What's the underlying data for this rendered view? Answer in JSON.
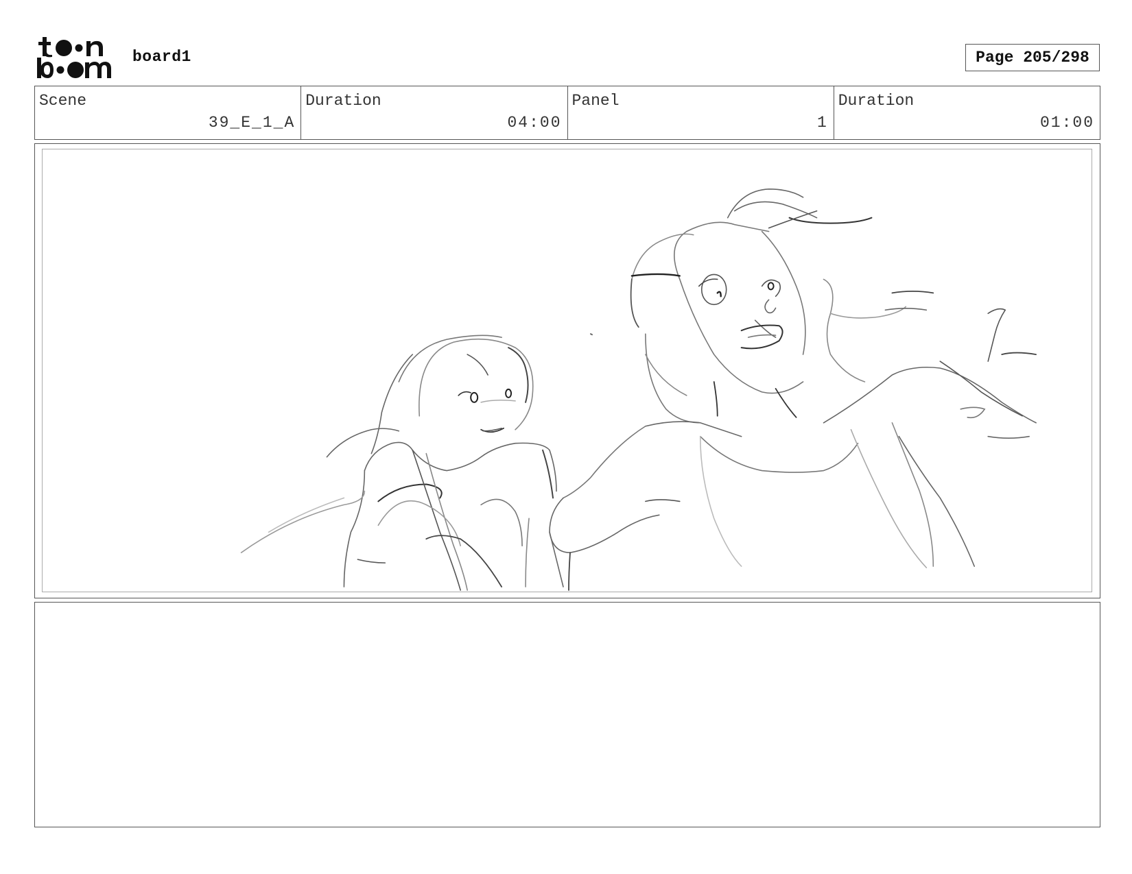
{
  "header": {
    "logo": {
      "text_top": "toon",
      "text_bottom": "boom"
    },
    "board_name": "board1",
    "page_label": "Page",
    "page_value": "205/298"
  },
  "info": {
    "scene_label": "Scene",
    "scene_value": "39_E_1_A",
    "scene_duration_label": "Duration",
    "scene_duration_value": "04:00",
    "panel_label": "Panel",
    "panel_value": "1",
    "panel_duration_label": "Duration",
    "panel_duration_value": "01:00"
  },
  "panel": {
    "image": "pencil-sketch-two-girls"
  },
  "notes": {
    "text": ""
  }
}
